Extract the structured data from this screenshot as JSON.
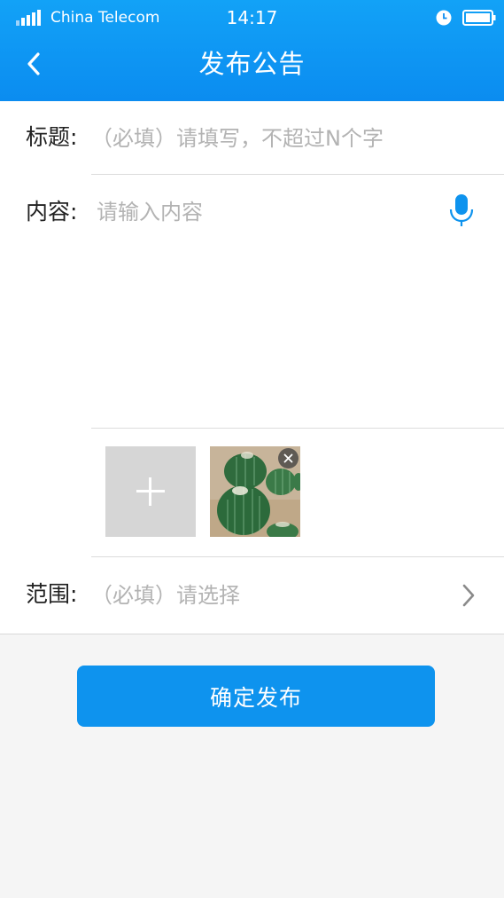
{
  "status_bar": {
    "carrier": "China Telecom",
    "time": "14:17",
    "icons": [
      "signal-icon",
      "alarm-icon",
      "battery-icon"
    ]
  },
  "nav": {
    "back_icon": "chevron-left-icon",
    "title": "发布公告"
  },
  "form": {
    "title_field": {
      "label": "标题:",
      "placeholder": "（必填）请填写，不超过N个字"
    },
    "content_field": {
      "label": "内容:",
      "placeholder": "请输入内容",
      "voice_icon": "microphone-icon"
    },
    "images": {
      "add_icon": "plus-icon",
      "remove_icon": "close-icon"
    },
    "scope_field": {
      "label": "范围:",
      "placeholder": "（必填）请选择",
      "chevron_icon": "chevron-right-icon"
    }
  },
  "submit": {
    "label": "确定发布"
  },
  "colors": {
    "primary": "#0e93ee",
    "header_top": "#12a2f7",
    "placeholder": "#b3b3b3",
    "background": "#f5f5f5"
  }
}
